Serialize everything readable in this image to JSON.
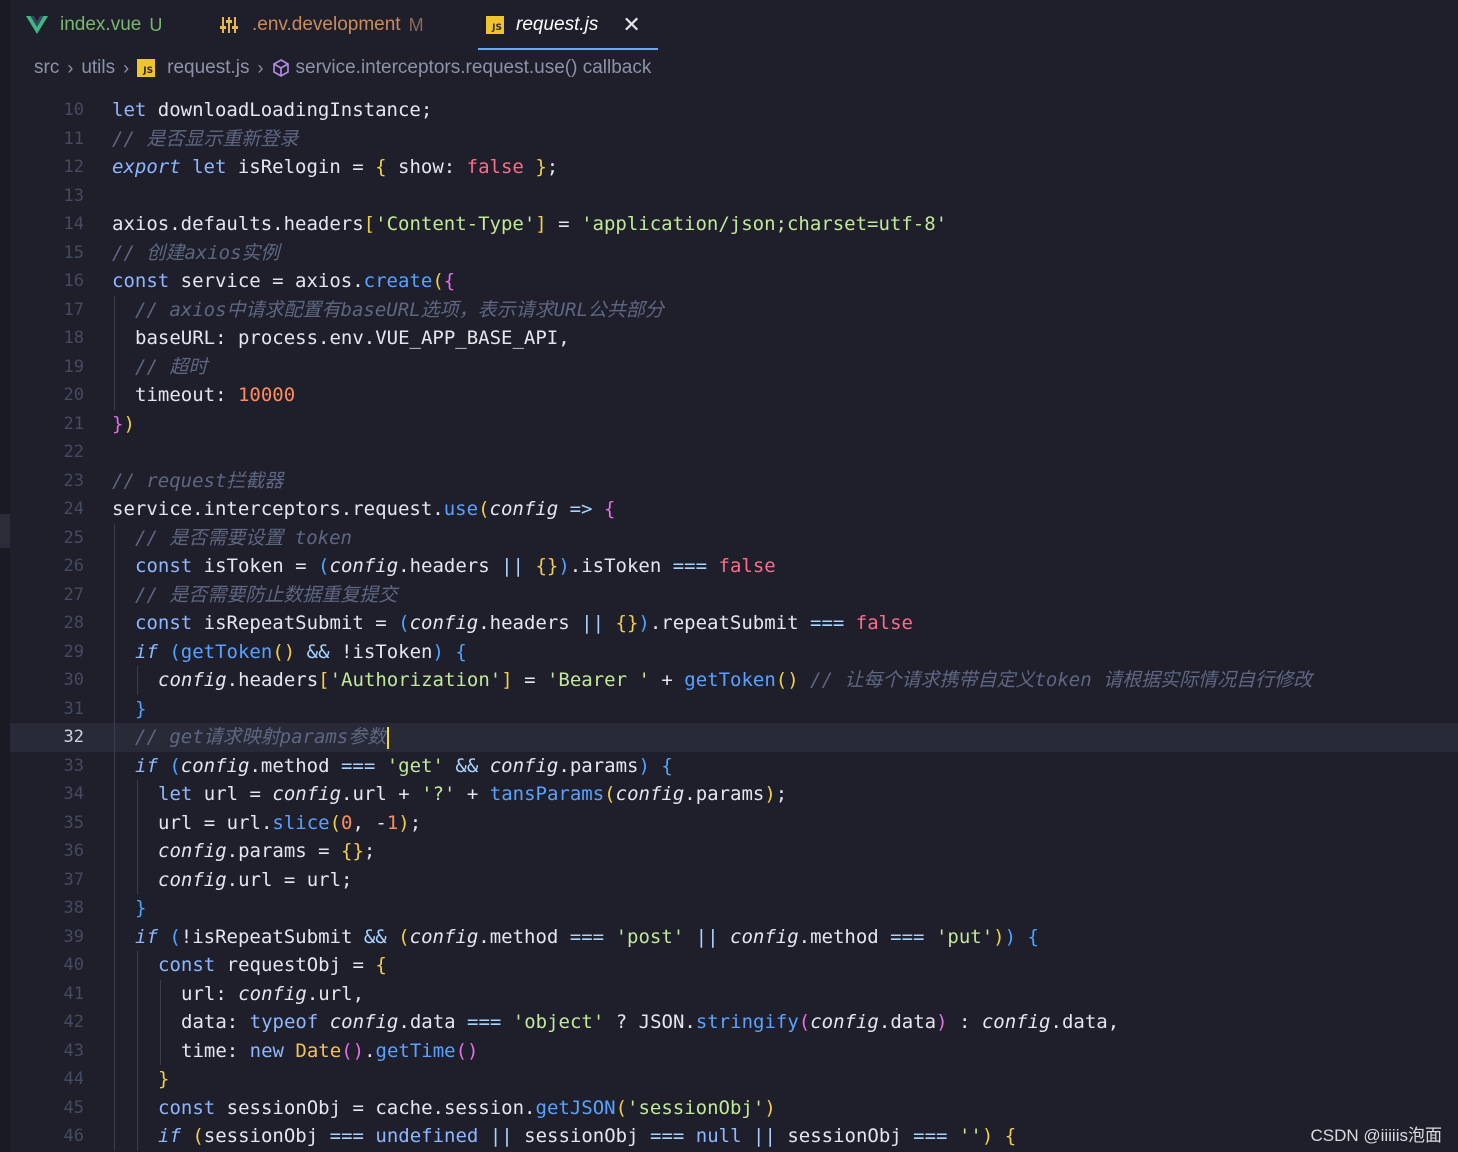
{
  "tabs": [
    {
      "label": "index.vue",
      "status": "U",
      "status_color": "#79b86c",
      "label_color": "#79b86c",
      "icon": "vue-icon"
    },
    {
      "label": ".env.development",
      "status": "M",
      "status_color": "#8a6a5e",
      "label_color": "#c98c5c",
      "icon": "settings-sliders-icon"
    },
    {
      "label": "request.js",
      "icon": "js-file-icon",
      "active": true
    }
  ],
  "icon_texts": {
    "js": "JS"
  },
  "glyphs": {
    "close": "✕",
    "sep": "›"
  },
  "breadcrumb": {
    "items": [
      "src",
      "utils",
      "request.js",
      "service.interceptors.request.use() callback"
    ]
  },
  "editor": {
    "current_line": 32,
    "lines": [
      {
        "n": "10",
        "indent": 0,
        "html": "<span class='k'>let</span> downloadLoadingInstance;"
      },
      {
        "n": "11",
        "indent": 0,
        "html": "<span class='c'>// 是否显示重新登录</span>"
      },
      {
        "n": "12",
        "indent": 0,
        "html": "<span class='ki'>export</span> <span class='k'>let</span> isRelogin = <span class='y'>{</span> show: <span class='b'>false</span> <span class='y'>}</span>;"
      },
      {
        "n": "13",
        "indent": 0,
        "html": ""
      },
      {
        "n": "14",
        "indent": 0,
        "html": "axios.defaults.headers<span class='y'>[</span><span class='s'>'Content-Type'</span><span class='y'>]</span> = <span class='s'>'application/json;charset=utf-8'</span>"
      },
      {
        "n": "15",
        "indent": 0,
        "html": "<span class='c'>// 创建axios实例</span>"
      },
      {
        "n": "16",
        "indent": 0,
        "html": "<span class='k'>const</span> service = axios.<span class='f'>create</span><span class='y'>(</span><span class='p'>{</span>"
      },
      {
        "n": "17",
        "indent": 1,
        "html": "<span class='c'>// axios中请求配置有baseURL选项，表示请求URL公共部分</span>"
      },
      {
        "n": "18",
        "indent": 1,
        "html": "baseURL: process.env.VUE_APP_BASE_API,"
      },
      {
        "n": "19",
        "indent": 1,
        "html": "<span class='c'>// 超时</span>"
      },
      {
        "n": "20",
        "indent": 1,
        "html": "timeout: <span class='n'>10000</span>"
      },
      {
        "n": "21",
        "indent": 0,
        "html": "<span class='p'>}</span><span class='y'>)</span>"
      },
      {
        "n": "22",
        "indent": 0,
        "html": ""
      },
      {
        "n": "23",
        "indent": 0,
        "html": "<span class='c'>// request拦截器</span>"
      },
      {
        "n": "24",
        "indent": 0,
        "html": "service.interceptors.request.<span class='f'>use</span><span class='y'>(</span><span class='i'>config</span> <span class='o'>=&gt;</span> <span class='p'>{</span>"
      },
      {
        "n": "25",
        "indent": 1,
        "html": "<span class='c'>// 是否需要设置 token</span>"
      },
      {
        "n": "26",
        "indent": 1,
        "html": "<span class='k'>const</span> isToken = <span class='bl'>(</span><span class='i'>config</span>.headers <span class='o'>||</span> <span class='y'>{}</span><span class='bl'>)</span>.isToken <span class='o'>===</span> <span class='b'>false</span>"
      },
      {
        "n": "27",
        "indent": 1,
        "html": "<span class='c'>// 是否需要防止数据重复提交</span>"
      },
      {
        "n": "28",
        "indent": 1,
        "html": "<span class='k'>const</span> isRepeatSubmit = <span class='bl'>(</span><span class='i'>config</span>.headers <span class='o'>||</span> <span class='y'>{}</span><span class='bl'>)</span>.repeatSubmit <span class='o'>===</span> <span class='b'>false</span>"
      },
      {
        "n": "29",
        "indent": 1,
        "html": "<span class='ki'>if</span> <span class='bl'>(</span><span class='f'>getToken</span><span class='y'>()</span> <span class='o'>&amp;&amp;</span> !isToken<span class='bl'>)</span> <span class='bl'>{</span>"
      },
      {
        "n": "30",
        "indent": 2,
        "html": "<span class='i'>config</span>.headers<span class='y'>[</span><span class='s'>'Authorization'</span><span class='y'>]</span> = <span class='s'>'Bearer '</span> + <span class='f'>getToken</span><span class='y'>()</span> <span class='c'>// 让每个请求携带自定义token 请根据实际情况自行修改</span>"
      },
      {
        "n": "31",
        "indent": 1,
        "html": "<span class='bl'>}</span>"
      },
      {
        "n": "32",
        "indent": 1,
        "html": "<span class='c'>// get请求映射params参数</span><span class='cursor'></span>"
      },
      {
        "n": "33",
        "indent": 1,
        "html": "<span class='ki'>if</span> <span class='bl'>(</span><span class='i'>config</span>.method <span class='o'>===</span> <span class='s'>'get'</span> <span class='o'>&amp;&amp;</span> <span class='i'>config</span>.params<span class='bl'>)</span> <span class='bl'>{</span>"
      },
      {
        "n": "34",
        "indent": 2,
        "html": "<span class='k'>let</span> url = <span class='i'>config</span>.url + <span class='s'>'?'</span> + <span class='f'>tansParams</span><span class='y'>(</span><span class='i'>config</span>.params<span class='y'>)</span>;"
      },
      {
        "n": "35",
        "indent": 2,
        "html": "url = url.<span class='f'>slice</span><span class='y'>(</span><span class='n'>0</span>, -<span class='n'>1</span><span class='y'>)</span>;"
      },
      {
        "n": "36",
        "indent": 2,
        "html": "<span class='i'>config</span>.params = <span class='y'>{}</span>;"
      },
      {
        "n": "37",
        "indent": 2,
        "html": "<span class='i'>config</span>.url = url;"
      },
      {
        "n": "38",
        "indent": 1,
        "html": "<span class='bl'>}</span>"
      },
      {
        "n": "39",
        "indent": 1,
        "html": "<span class='ki'>if</span> <span class='bl'>(</span>!isRepeatSubmit <span class='o'>&amp;&amp;</span> <span class='y'>(</span><span class='i'>config</span>.method <span class='o'>===</span> <span class='s'>'post'</span> <span class='o'>||</span> <span class='i'>config</span>.method <span class='o'>===</span> <span class='s'>'put'</span><span class='y'>)</span><span class='bl'>)</span> <span class='bl'>{</span>"
      },
      {
        "n": "40",
        "indent": 2,
        "html": "<span class='k'>const</span> requestObj = <span class='y'>{</span>"
      },
      {
        "n": "41",
        "indent": 3,
        "html": "url: <span class='i'>config</span>.url,"
      },
      {
        "n": "42",
        "indent": 3,
        "html": "data: <span class='k'>typeof</span> <span class='i'>config</span>.data <span class='o'>===</span> <span class='s'>'object'</span> ? JSON.<span class='f'>stringify</span><span class='p'>(</span><span class='i'>config</span>.data<span class='p'>)</span> : <span class='i'>config</span>.data,"
      },
      {
        "n": "43",
        "indent": 3,
        "html": "time: <span class='k'>new</span> <span class='cl'>Date</span><span class='p'>()</span>.<span class='f'>getTime</span><span class='p'>()</span>"
      },
      {
        "n": "44",
        "indent": 2,
        "html": "<span class='y'>}</span>"
      },
      {
        "n": "45",
        "indent": 2,
        "html": "<span class='k'>const</span> sessionObj = cache.session.<span class='f'>getJSON</span><span class='y'>(</span><span class='s'>'sessionObj'</span><span class='y'>)</span>"
      },
      {
        "n": "46",
        "indent": 2,
        "html": "<span class='ki'>if</span> <span class='y'>(</span>sessionObj <span class='o'>===</span> <span class='k'>undefined</span> <span class='o'>||</span> sessionObj <span class='o'>===</span> <span class='k'>null</span> <span class='o'>||</span> sessionObj <span class='o'>===</span> <span class='s'>''</span><span class='y'>)</span> <span class='y'>{</span>"
      }
    ]
  },
  "watermark": "CSDN @iiiiis泡面"
}
